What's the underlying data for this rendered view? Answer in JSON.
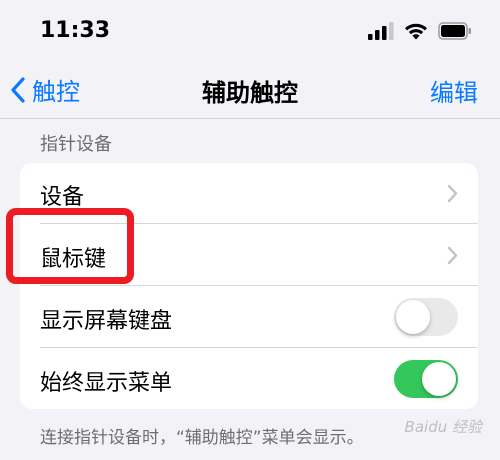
{
  "status_bar": {
    "time": "11:33",
    "icons": [
      "cellular-signal-icon",
      "wifi-icon",
      "battery-icon"
    ]
  },
  "nav": {
    "back_label": "触控",
    "title": "辅助触控",
    "edit_label": "编辑"
  },
  "section": {
    "header": "指针设备",
    "rows": [
      {
        "label": "设备",
        "accessory": "chevron"
      },
      {
        "label": "鼠标键",
        "accessory": "chevron",
        "highlighted": true
      },
      {
        "label": "显示屏幕键盘",
        "accessory": "toggle",
        "toggle_on": false
      },
      {
        "label": "始终显示菜单",
        "accessory": "toggle",
        "toggle_on": true
      }
    ],
    "footer": "连接指针设备时，“辅助触控”菜单会显示。"
  },
  "colors": {
    "accent": "#0a7aff",
    "toggle_on": "#34c759",
    "highlight": "#ec1c24",
    "background": "#f2f2f7"
  },
  "watermark": "Baidu 经验"
}
